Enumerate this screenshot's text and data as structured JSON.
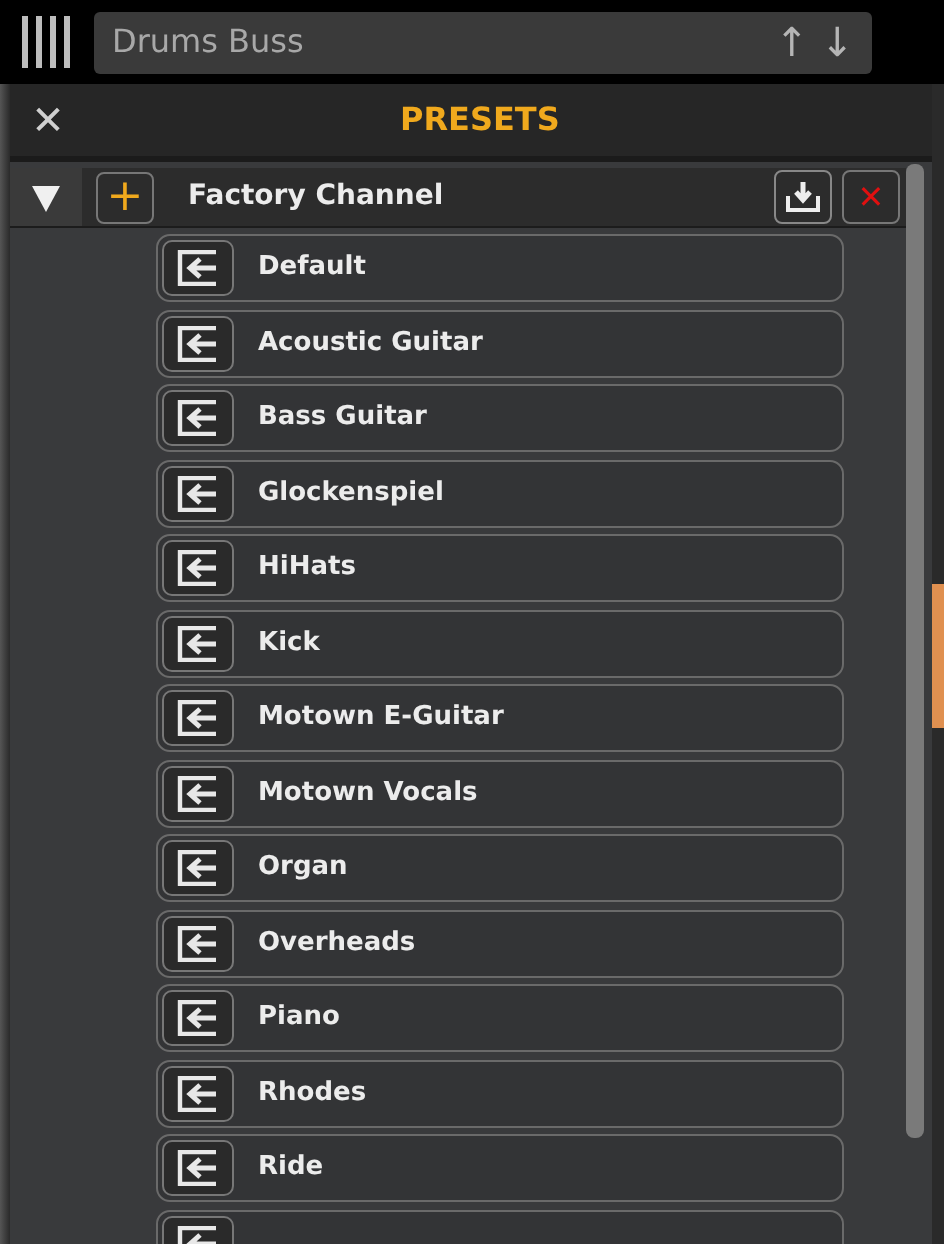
{
  "track": {
    "name": "Drums Buss",
    "up": "↑",
    "down": "↓"
  },
  "panel": {
    "title": "PRESETS",
    "close": "✕"
  },
  "group": {
    "name": "Factory Channel",
    "expanded": true,
    "add": "+",
    "delete": "✕"
  },
  "presets": [
    {
      "kind": "full",
      "name": "Default"
    },
    {
      "kind": "full",
      "name": "Acoustic Guitar"
    },
    {
      "kind": "full",
      "name": "Bass Guitar"
    },
    {
      "kind": "full",
      "name": "Glockenspiel"
    },
    {
      "kind": "full",
      "name": "HiHats"
    },
    {
      "kind": "full",
      "name": "Kick"
    },
    {
      "kind": "full",
      "name": "Motown E-Guitar"
    },
    {
      "kind": "full",
      "name": "Motown Vocals"
    },
    {
      "kind": "full",
      "name": "Organ"
    },
    {
      "kind": "full",
      "name": "Overheads"
    },
    {
      "kind": "full",
      "name": "Piano"
    },
    {
      "kind": "full",
      "name": "Rhodes"
    },
    {
      "kind": "full",
      "name": "Ride"
    },
    {
      "kind": "cut-off"
    }
  ]
}
